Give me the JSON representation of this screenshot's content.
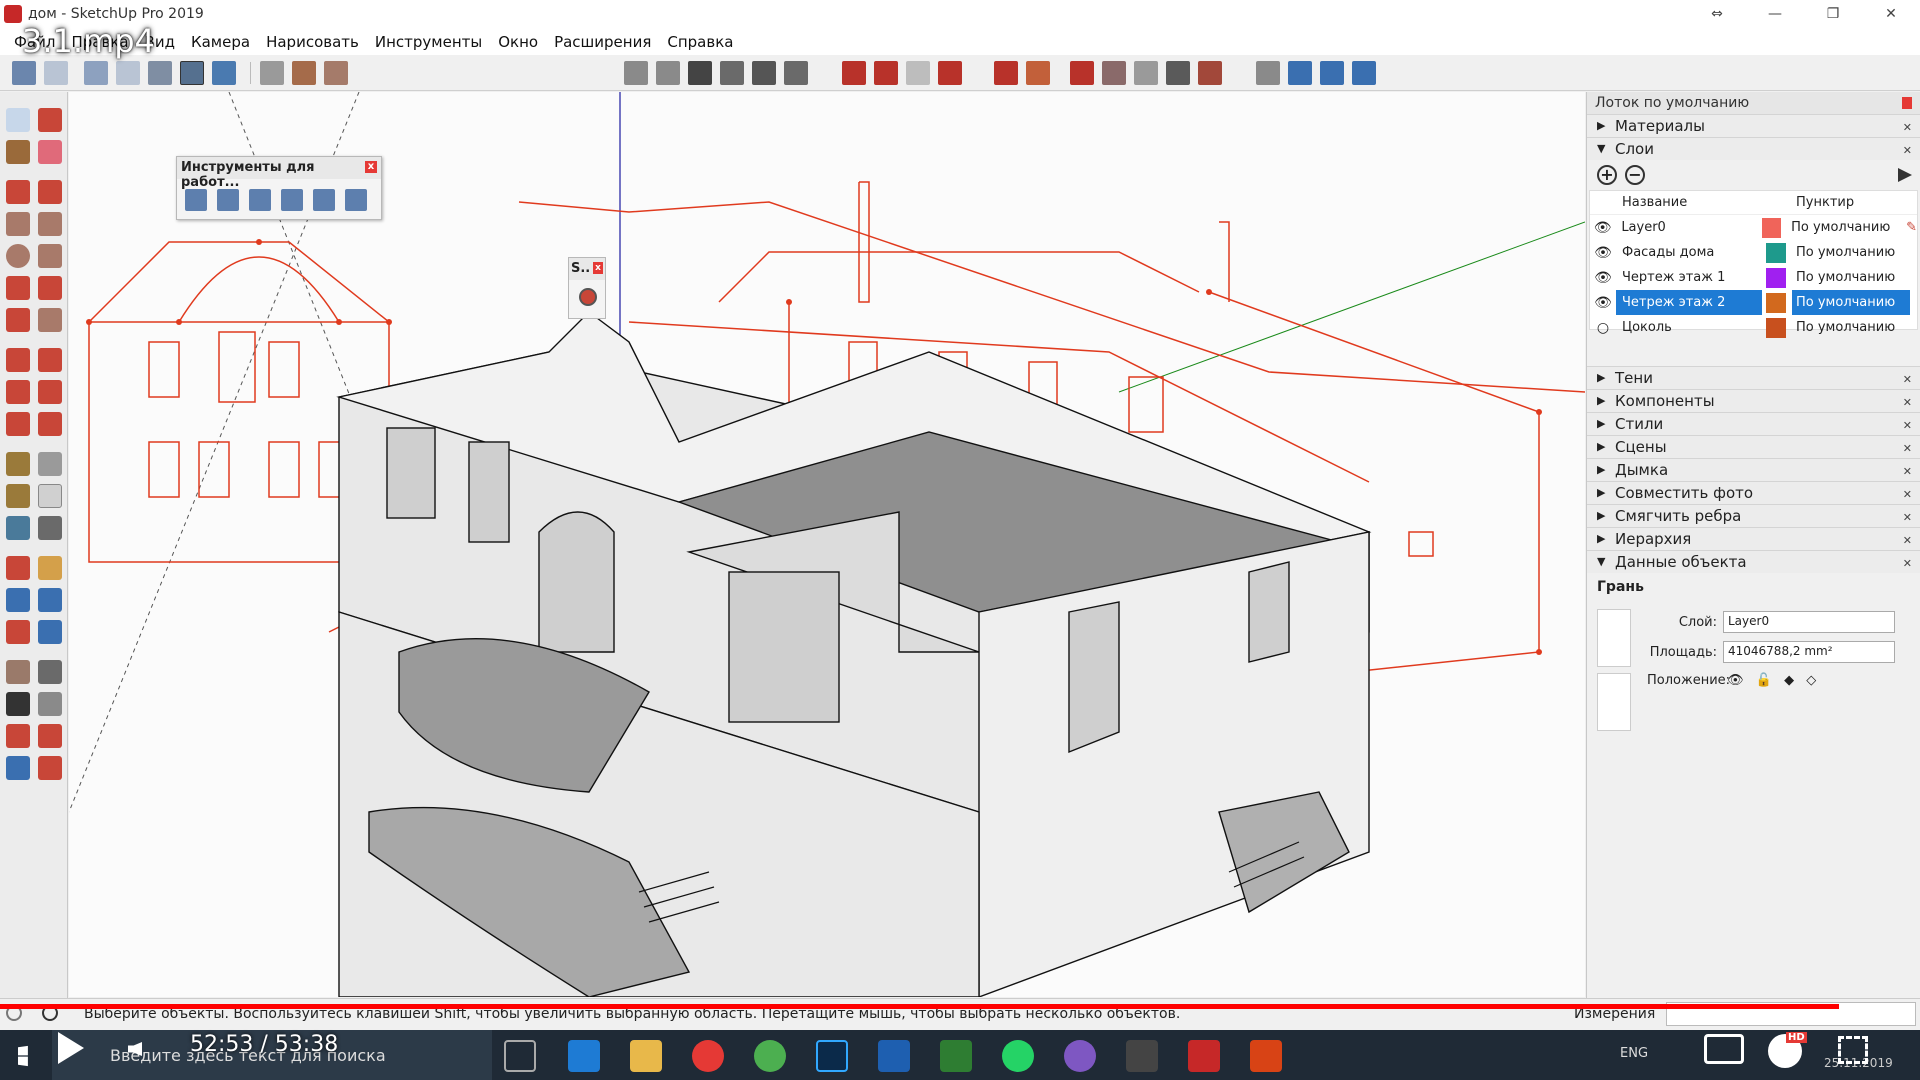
{
  "window": {
    "title": "дом - SketchUp Pro 2019",
    "controls": [
      "⇔",
      "—",
      "❐",
      "✕"
    ]
  },
  "video_title": "3.1.mp4",
  "menu": [
    "Файл",
    "Правка",
    "Вид",
    "Камера",
    "Нарисовать",
    "Инструменты",
    "Окно",
    "Расширения",
    "Справка"
  ],
  "float_tools": {
    "title": "Инструменты для работ...",
    "close": "x"
  },
  "float_s": {
    "title": "S..",
    "close": "x"
  },
  "tray": {
    "title": "Лоток по умолчанию",
    "materials": "Материалы",
    "layers": "Слои",
    "layers_add": "+",
    "layers_remove": "−",
    "layers_col_name": "Название",
    "layers_col_dash": "Пунктир",
    "layers_items": [
      {
        "name": "Layer0",
        "color": "#f0645a",
        "dash": "По умолчанию",
        "visible": true
      },
      {
        "name": "Фасады дома",
        "color": "#1e9a8c",
        "dash": "По умолчанию",
        "visible": true
      },
      {
        "name": "Чертеж этаж 1",
        "color": "#a020f0",
        "dash": "По умолчанию",
        "visible": true
      },
      {
        "name": "Четреж этаж 2",
        "color": "#d2691e",
        "dash": "По умолчанию",
        "visible": true
      },
      {
        "name": "Цоколь",
        "color": "#c8501e",
        "dash": "По умолчанию",
        "visible": false
      }
    ],
    "sections": [
      "Тени",
      "Компоненты",
      "Стили",
      "Сцены",
      "Дымка",
      "Совместить фото",
      "Смягчить ребра",
      "Иерархия"
    ],
    "entity": "Данные объекта",
    "entity_type": "Грань",
    "entity_layer_label": "Слой:",
    "entity_layer": "Layer0",
    "entity_area_label": "Площадь:",
    "entity_area": "41046788,2 mm²",
    "entity_pos_label": "Положение:"
  },
  "status": {
    "message": "Выберите объекты. Воспользуйтесь клавишей Shift, чтобы увеличить выбранную область. Перетащите мышь, чтобы выбрать несколько объектов.",
    "measure_label": "Измерения",
    "measure_value": ""
  },
  "video": {
    "time": "52:53 / 53:38",
    "progress": 0.986
  },
  "taskbar": {
    "search": "Введите здесь текст для поиска",
    "date": "25.11.2019",
    "lang": "ENG"
  },
  "colors": {
    "red": "#e03a1e",
    "accent": "#1e7bd4"
  }
}
